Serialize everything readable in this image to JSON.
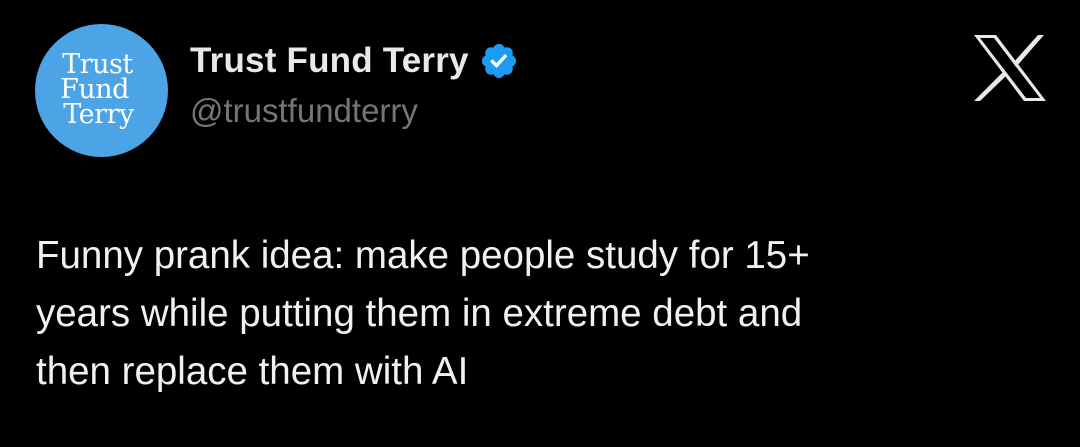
{
  "author": {
    "avatar_lines": [
      "Trust",
      "Fund",
      "Terry"
    ],
    "display_name": "Trust Fund Terry",
    "handle": "@trustfundterry",
    "verified_icon": "verified-badge-icon",
    "avatar_color": "#4ca3e6"
  },
  "platform": {
    "logo_icon": "x-logo-icon"
  },
  "tweet": {
    "lines": [
      "Funny prank idea: make people study for 15+",
      "years while putting them in extreme debt and",
      "then replace them with AI"
    ]
  },
  "colors": {
    "background": "#000000",
    "verified_blue": "#1d9bf0",
    "handle_gray": "#71767b",
    "text": "#e7e9ea"
  }
}
